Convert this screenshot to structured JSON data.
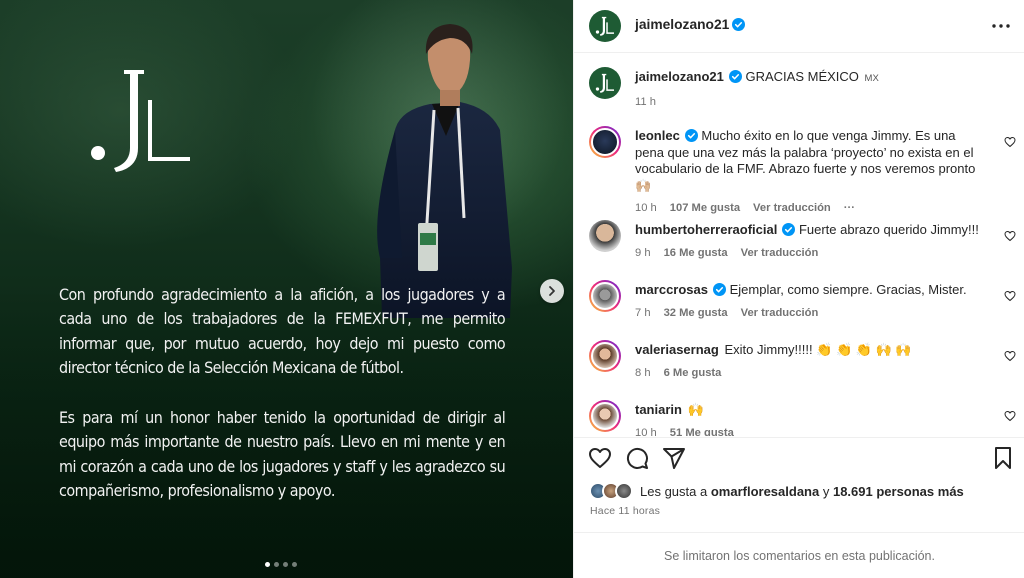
{
  "post": {
    "logo_text": ".JL",
    "paragraph_1": "Con profundo agradecimiento a la afición, a los jugadores y a cada uno de los trabajadores de la FEMEXFUT, me permito informar que, por mutuo acuerdo, hoy dejo mi puesto como director técnico de la Selección Mexicana de fútbol.",
    "paragraph_2": "Es para mí un honor haber tenido la oportunidad de dirigir al equipo más importante de nuestro país. Llevo en mi mente y en mi corazón a cada uno de los jugadores y staff y les agradezco su compañerismo, profesionalismo y apoyo.",
    "carousel_index": 1,
    "carousel_count": 4
  },
  "header": {
    "username": "jaimelozano21",
    "avatar_text": ".JL"
  },
  "caption": {
    "username": "jaimelozano21",
    "text": "GRACIAS MÉXICO",
    "flag": "MX",
    "time": "11 h"
  },
  "comments": [
    {
      "username": "leonlec",
      "text": "Mucho éxito en lo que venga Jimmy. Es una pena que una vez más la palabra ‘proyecto’ no exista en el vocabulario de la FMF. Abrazo fuerte y nos veremos pronto 🙌🏼",
      "time": "10 h",
      "likes": "107 Me gusta",
      "translate": "Ver traducción",
      "more": "···"
    },
    {
      "username": "humbertoherreraoficial",
      "text": "Fuerte abrazo querido Jimmy!!!",
      "time": "9 h",
      "likes": "16 Me gusta",
      "translate": "Ver traducción"
    },
    {
      "username": "marccrosas",
      "text": "Ejemplar, como siempre. Gracias, Mister.",
      "time": "7 h",
      "likes": "32 Me gusta",
      "translate": "Ver traducción"
    },
    {
      "username": "valeriasernag",
      "text": "Exito Jimmy!!!!! 👏 👏 👏 🙌 🙌",
      "time": "8 h",
      "likes": "6 Me gusta"
    },
    {
      "username": "taniarin",
      "text": "🙌",
      "time": "10 h",
      "likes": "51 Me gusta"
    }
  ],
  "likes_line": {
    "prefix": "Les gusta a",
    "user": "omarfloresaldana",
    "connector": "y",
    "count": "18.691 personas más"
  },
  "time_ago": "Hace 11 horas",
  "limited_notice": "Se limitaron los comentarios en esta publicación.",
  "colors": {
    "brand_green": "#1e5b34",
    "verified_blue": "#0095f6",
    "meta_gray": "#737373"
  },
  "icons": {
    "more": "more-horizontal-icon",
    "like": "heart-icon",
    "comment": "comment-icon",
    "share": "share-icon",
    "save": "bookmark-icon",
    "next": "chevron-right-icon",
    "verified": "verified-badge-icon"
  }
}
